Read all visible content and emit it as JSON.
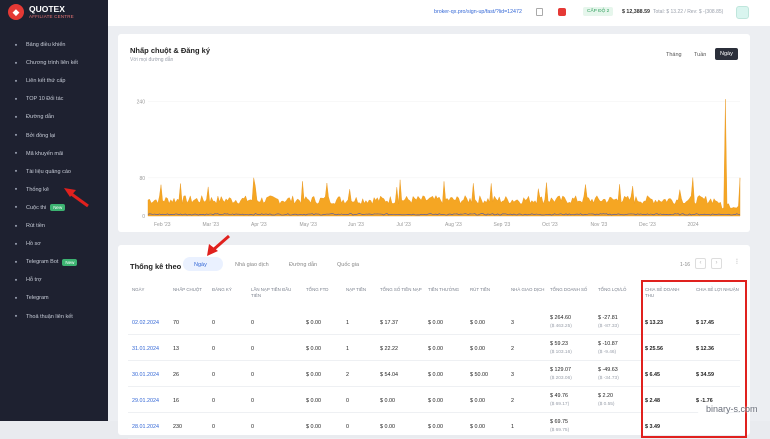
{
  "brand": {
    "name": "QUOTEX",
    "tagline": "AFFILIATE CENTRE"
  },
  "sidebar": {
    "items": [
      {
        "label": "Bảng điều khiển",
        "icon": "grid-icon"
      },
      {
        "label": "Chương trình liên kết",
        "icon": "folder-icon"
      },
      {
        "label": "Liên kết thứ cấp",
        "icon": "send-icon"
      },
      {
        "label": "TOP 10 Đối tác",
        "icon": "trend-icon"
      },
      {
        "label": "Đường dẫn",
        "icon": "link-icon"
      },
      {
        "label": "Bởi đồng lại",
        "icon": "refresh-icon"
      },
      {
        "label": "Mã khuyến mãi",
        "icon": "tag-icon"
      },
      {
        "label": "Tài liệu quảng cáo",
        "icon": "doc-icon"
      },
      {
        "label": "Thống kê",
        "icon": "pie-icon"
      },
      {
        "label": "Cuộc thi",
        "icon": "trophy-icon",
        "badge": "New"
      },
      {
        "label": "Rút tiền",
        "icon": "wallet-icon"
      },
      {
        "label": "Hồ sơ",
        "icon": "user-icon"
      },
      {
        "label": "Telegram Bot",
        "icon": "bot-icon",
        "badge": "New"
      },
      {
        "label": "Hỗ trợ",
        "icon": "support-icon"
      },
      {
        "label": "Telegram",
        "icon": "telegram-icon"
      },
      {
        "label": "Thoả thuận liên kết",
        "icon": "contract-icon"
      }
    ]
  },
  "topbar": {
    "link": "broker-qx.pro/sign-up/fast/?lid=12472",
    "level": "CẤP ĐỘ 2",
    "balance": "$ 12,388.59",
    "balance_sub": "Total: $ 13.22 / Rev: $ -(308.85)"
  },
  "chart_card": {
    "title": "Nhấp chuột & Đăng ký",
    "subtitle": "Với mọi đường dẫn",
    "tabs": [
      "Tháng",
      "Tuần",
      "Ngày"
    ],
    "active_tab": "Ngày"
  },
  "chart_data": {
    "type": "area",
    "title": "Nhấp chuột & Đăng ký",
    "x_labels": [
      "Feb '23",
      "Mar '23",
      "Apr '23",
      "May '23",
      "Jun '23",
      "Jul '23",
      "Aug '23",
      "Sep '23",
      "Oct '23",
      "Nov '23",
      "Dec '23",
      "2024"
    ],
    "y_ticks": [
      "240",
      "80",
      "0"
    ],
    "ylim": [
      0,
      260
    ],
    "series": [
      {
        "color": "#f5a623"
      },
      {
        "color": "#3f51b5"
      }
    ]
  },
  "stats": {
    "title": "Thống kê theo",
    "tabs": [
      "Ngày",
      "Nhà giao dịch",
      "Đường dẫn",
      "Quốc gia"
    ],
    "active_tab": "Ngày",
    "pagination": "1-16",
    "headers": [
      "NGÀY",
      "NHẤP CHUỘT",
      "ĐĂNG KÝ",
      "LẦN NẠP TIỀN ĐẦU TIÊN",
      "TỔNG FTD",
      "NẠP TIỀN",
      "TỔNG SỐ TIỀN NẠP",
      "TIỀN THƯỞNG",
      "RÚT TIỀN",
      "NHÀ GIAO DỊCH",
      "TỔNG DOANH SỐ",
      "TỔNG LỢI/LỖ",
      "CHIA SẺ DOANH THU",
      "CHIA SẺ LỢI NHUẬN"
    ],
    "rows": [
      [
        "02.02.2024",
        "70",
        "0",
        "0",
        "$ 0.00",
        "1",
        "$ 17.37",
        "$ 0.00",
        "$ 0.00",
        "3",
        "$ 264.60",
        "($ 463.25)",
        "$ -27.81",
        "($ -87.33)",
        "$ 13.23",
        "$ 17.45"
      ],
      [
        "31.01.2024",
        "13",
        "0",
        "0",
        "$ 0.00",
        "1",
        "$ 22.22",
        "$ 0.00",
        "$ 0.00",
        "2",
        "$ 59.23",
        "($ 103.16)",
        "$ -10.87",
        "($ -9.46)",
        "$ 25.56",
        "$ 12.36"
      ],
      [
        "30.01.2024",
        "26",
        "0",
        "0",
        "$ 0.00",
        "2",
        "$ 54.04",
        "$ 0.00",
        "$ 50.00",
        "3",
        "$ 129.07",
        "($ 203.06)",
        "$ -49.63",
        "($ -34.73)",
        "$ 6.45",
        "$ 34.59"
      ],
      [
        "29.01.2024",
        "16",
        "0",
        "0",
        "$ 0.00",
        "0",
        "$ 0.00",
        "$ 0.00",
        "$ 0.00",
        "2",
        "$ 49.76",
        "($ 69.17)",
        "$ 2.20",
        "($ 0.55)",
        "$ 2.48",
        "$ -1.76"
      ],
      [
        "28.01.2024",
        "230",
        "0",
        "0",
        "$ 0.00",
        "0",
        "$ 0.00",
        "$ 0.00",
        "$ 0.00",
        "1",
        "$ 69.75",
        "($ 69.75)",
        "",
        "",
        "$ 3.49",
        ""
      ]
    ]
  },
  "watermark": "binary-s.com"
}
